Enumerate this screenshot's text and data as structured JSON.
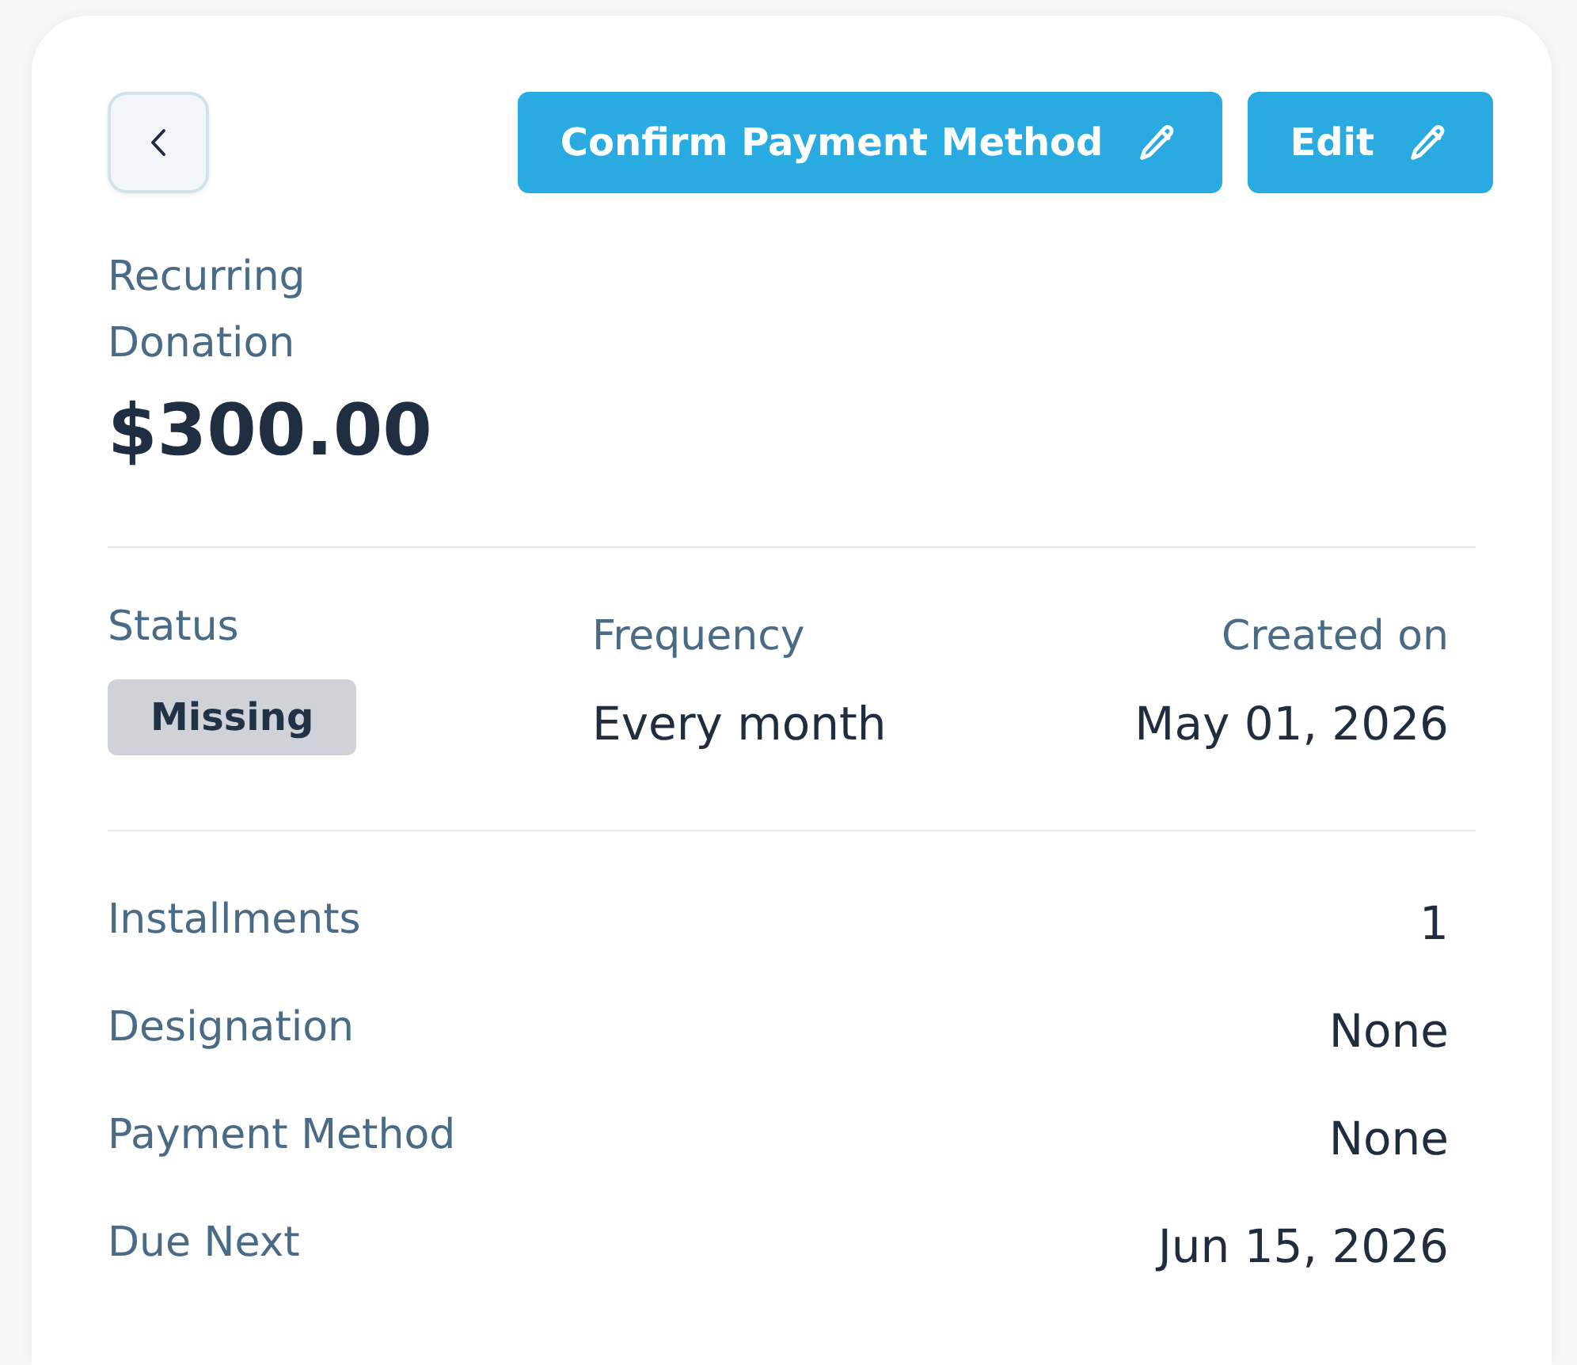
{
  "actions": [
    {
      "label": "Confirm Payment Method"
    },
    {
      "label": "Edit"
    }
  ],
  "summary": {
    "label": "Recurring Donation",
    "amount": "$300.00"
  },
  "overview": [
    {
      "kind": "badge",
      "label": "Status",
      "value": "Missing"
    },
    {
      "kind": "text",
      "label": "Frequency",
      "value": "Every month"
    },
    {
      "kind": "text",
      "label": "Created on",
      "value": "May 01, 2026"
    }
  ],
  "details": [
    {
      "label": "Installments",
      "value": "1"
    },
    {
      "label": "Designation",
      "value": "None"
    },
    {
      "label": "Payment Method",
      "value": "None"
    },
    {
      "label": "Due Next",
      "value": "Jun 15, 2026"
    }
  ]
}
